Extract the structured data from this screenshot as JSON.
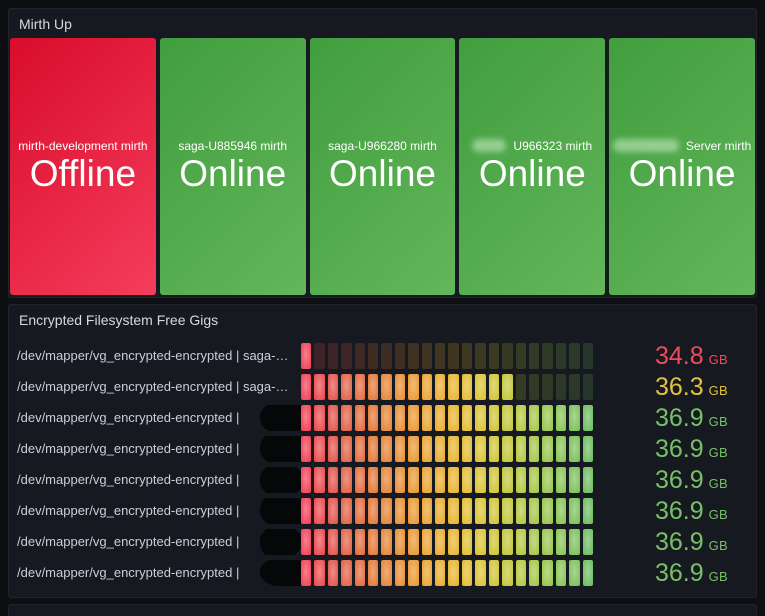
{
  "mirth_panel": {
    "title": "Mirth Up",
    "offline_color_start": "#d90c2b",
    "offline_color_end": "#f53d5c",
    "online_color_start": "#419e3f",
    "online_color_end": "#63b65a",
    "tiles": [
      {
        "label": "mirth-development mirth",
        "value": "Offline",
        "state": "offline",
        "label_redacted_prefix": false
      },
      {
        "label": "saga-U885946 mirth",
        "value": "Online",
        "state": "online",
        "label_redacted_prefix": false
      },
      {
        "label": "saga-U966280 mirth",
        "value": "Online",
        "state": "online",
        "label_redacted_prefix": false
      },
      {
        "label": "U966323 mirth",
        "value": "Online",
        "state": "online",
        "label_redacted_prefix": true
      },
      {
        "label": "Server mirth",
        "value": "Online",
        "state": "online",
        "label_redacted_prefix": true
      }
    ]
  },
  "fs_panel": {
    "title": "Encrypted Filesystem Free Gigs",
    "unit": "GB",
    "gauge": {
      "cells": 22,
      "min_gb": 34.66,
      "max_gb": 36.9,
      "gradient_stops": [
        {
          "pos": 0.0,
          "color": "#f2495c"
        },
        {
          "pos": 0.1,
          "color": "#e25c50"
        },
        {
          "pos": 0.25,
          "color": "#e5813f"
        },
        {
          "pos": 0.45,
          "color": "#ecac39"
        },
        {
          "pos": 0.6,
          "color": "#e2c43a"
        },
        {
          "pos": 0.75,
          "color": "#bcca46"
        },
        {
          "pos": 0.9,
          "color": "#8fc75a"
        },
        {
          "pos": 1.0,
          "color": "#74c066"
        }
      ]
    },
    "rows": [
      {
        "label": "/dev/mapper/vg_encrypted-encrypted | saga-…",
        "value": "34.8",
        "value_gb": 34.8,
        "lit_cells": 1,
        "value_color": "#f2495c",
        "label_redacted": false
      },
      {
        "label": "/dev/mapper/vg_encrypted-encrypted | saga-…",
        "value": "36.3",
        "value_gb": 36.3,
        "lit_cells": 16,
        "value_color": "#e2c13e",
        "label_redacted": false
      },
      {
        "label": "/dev/mapper/vg_encrypted-encrypted | ",
        "value": "36.9",
        "value_gb": 36.9,
        "lit_cells": 22,
        "value_color": "#76c167",
        "label_redacted": true
      },
      {
        "label": "/dev/mapper/vg_encrypted-encrypted | ",
        "value": "36.9",
        "value_gb": 36.9,
        "lit_cells": 22,
        "value_color": "#76c167",
        "label_redacted": true
      },
      {
        "label": "/dev/mapper/vg_encrypted-encrypted | ",
        "value": "36.9",
        "value_gb": 36.9,
        "lit_cells": 22,
        "value_color": "#76c167",
        "label_redacted": true
      },
      {
        "label": "/dev/mapper/vg_encrypted-encrypted | ",
        "value": "36.9",
        "value_gb": 36.9,
        "lit_cells": 22,
        "value_color": "#76c167",
        "label_redacted": true
      },
      {
        "label": "/dev/mapper/vg_encrypted-encrypted | ",
        "value": "36.9",
        "value_gb": 36.9,
        "lit_cells": 22,
        "value_color": "#76c167",
        "label_redacted": true
      },
      {
        "label": "/dev/mapper/vg_encrypted-encrypted | ",
        "value": "36.9",
        "value_gb": 36.9,
        "lit_cells": 22,
        "value_color": "#76c167",
        "label_redacted": true
      }
    ]
  }
}
